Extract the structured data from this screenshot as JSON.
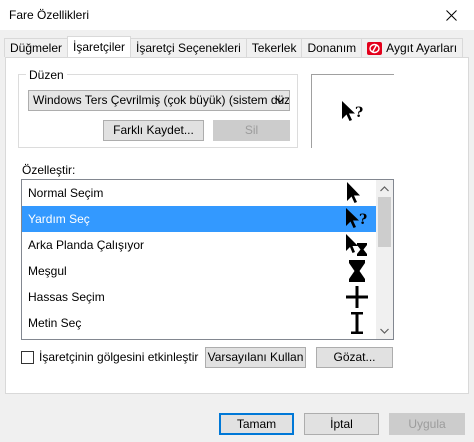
{
  "window": {
    "title": "Fare Özellikleri",
    "close_icon": "close-icon"
  },
  "tabs": [
    {
      "label": "Düğmeler"
    },
    {
      "label": "İşaretçiler",
      "active": true
    },
    {
      "label": "İşaretçi Seçenekleri"
    },
    {
      "label": "Tekerlek"
    },
    {
      "label": "Donanım"
    },
    {
      "label": "Aygıt Ayarları",
      "icon": "hardware-logo-icon",
      "icon_color": "#e3001b"
    }
  ],
  "scheme": {
    "group_label": "Düzen",
    "selected": "Windows Ters Çevrilmiş (çok büyük) (sistem düzeni)",
    "save_as_label": "Farklı Kaydet...",
    "delete_label": "Sil"
  },
  "preview": {
    "icon": "help-select-cursor-icon"
  },
  "customize": {
    "label": "Özelleştir:",
    "items": [
      {
        "label": "Normal Seçim",
        "icon": "arrow-cursor-icon"
      },
      {
        "label": "Yardım Seç",
        "icon": "help-select-cursor-icon",
        "selected": true
      },
      {
        "label": "Arka Planda Çalışıyor",
        "icon": "working-in-background-cursor-icon"
      },
      {
        "label": "Meşgul",
        "icon": "busy-hourglass-cursor-icon"
      },
      {
        "label": "Hassas Seçim",
        "icon": "precision-crosshair-cursor-icon"
      },
      {
        "label": "Metin Seç",
        "icon": "text-ibeam-cursor-icon"
      }
    ]
  },
  "shadow_option": {
    "label": "İşaretçinin gölgesini etkinleştir",
    "checked": false
  },
  "buttons": {
    "use_default": "Varsayılanı Kullan",
    "browse": "Gözat...",
    "ok": "Tamam",
    "cancel": "İptal",
    "apply": "Uygula"
  },
  "colors": {
    "selection": "#3399ff",
    "default_button_border": "#0078d7"
  }
}
